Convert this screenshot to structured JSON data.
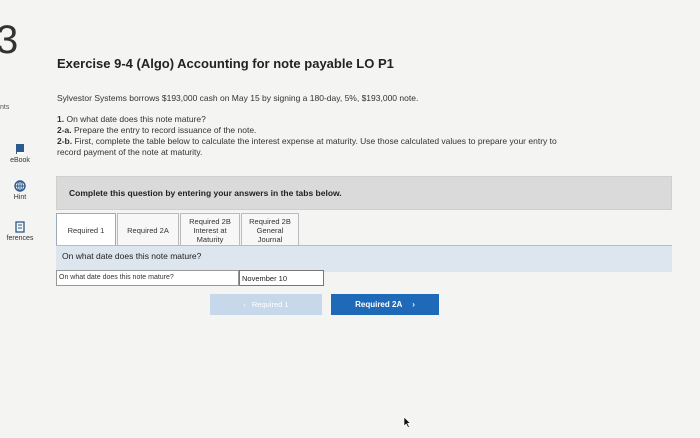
{
  "question_number": "3",
  "points_label": "nts",
  "sidebar": {
    "items": [
      {
        "label": "eBook",
        "icon": "book-icon"
      },
      {
        "label": "Hint",
        "icon": "globe-icon"
      },
      {
        "label": "ferences",
        "icon": "references-icon"
      }
    ]
  },
  "exercise": {
    "title": "Exercise 9-4 (Algo) Accounting for note payable LO P1",
    "intro": "Sylvestor Systems borrows $193,000 cash on May 15 by signing a 180-day, 5%, $193,000 note.",
    "instructions": [
      {
        "prefix": "1.",
        "text": " On what date does this note mature?"
      },
      {
        "prefix": "2-a.",
        "text": " Prepare the entry to record issuance of the note."
      },
      {
        "prefix": "2-b.",
        "text": " First, complete the table below to calculate the interest expense at maturity. Use those calculated values to prepare your entry to"
      }
    ],
    "instructions_continuation": "record payment of the note at maturity."
  },
  "banner_text": "Complete this question by entering your answers in the tabs below.",
  "tabs": [
    {
      "label": "Required 1",
      "active": true
    },
    {
      "label": "Required 2A",
      "active": false
    },
    {
      "label": "Required 2B\nInterest at\nMaturity",
      "active": false
    },
    {
      "label": "Required 2B\nGeneral\nJournal",
      "active": false
    }
  ],
  "panel": {
    "prompt": "On what date does this note mature?",
    "answer_label": "On what date does this note mature?",
    "answer_value": "November 10"
  },
  "nav": {
    "prev_label": "Required 1",
    "next_label": "Required 2A",
    "prev_arrow": "‹",
    "next_arrow": "›"
  },
  "colors": {
    "accent": "#1e69b8",
    "disabled_button": "#c6d8ea",
    "panel_bg": "#dde6ee"
  }
}
